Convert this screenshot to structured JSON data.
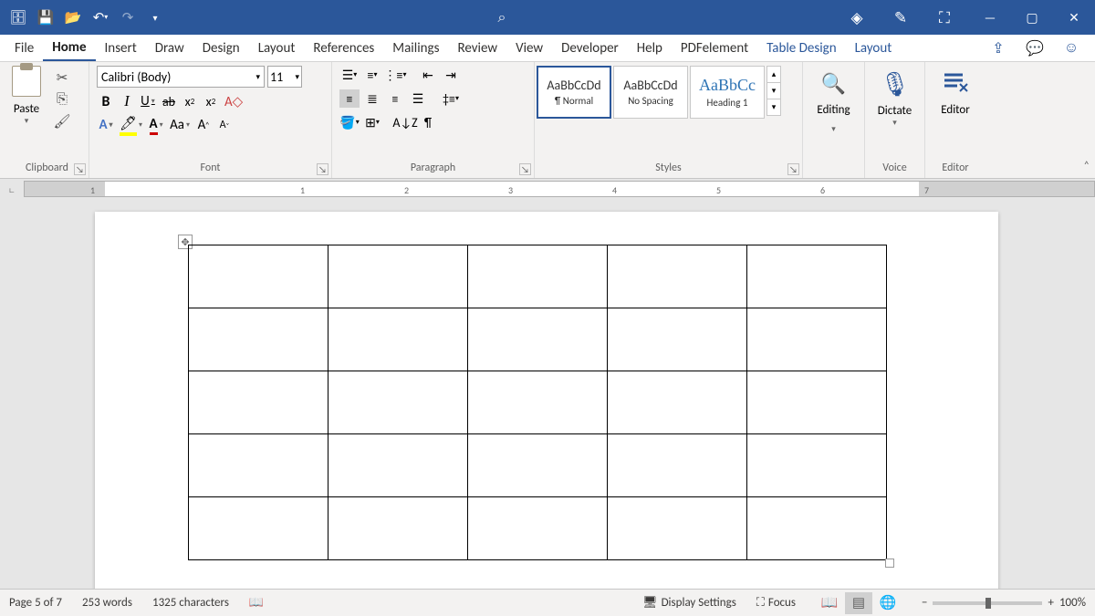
{
  "tabs": {
    "file": "File",
    "home": "Home",
    "insert": "Insert",
    "draw": "Draw",
    "design": "Design",
    "layout": "Layout",
    "references": "References",
    "mailings": "Mailings",
    "review": "Review",
    "view": "View",
    "developer": "Developer",
    "help": "Help",
    "pdf": "PDFelement",
    "table_design": "Table Design",
    "ctx_layout": "Layout"
  },
  "clipboard": {
    "paste": "Paste",
    "label": "Clipboard"
  },
  "font": {
    "family": "Calibri (Body)",
    "size": "11",
    "label": "Font"
  },
  "paragraph": {
    "label": "Paragraph"
  },
  "styles": {
    "label": "Styles",
    "preview": "AaBbCcDd",
    "preview_h1": "AaBbCc",
    "names": {
      "normal": "¶ Normal",
      "nospacing": "No Spacing",
      "h1": "Heading 1"
    }
  },
  "editing": {
    "label": "Editing"
  },
  "voice": {
    "dictate": "Dictate",
    "label": "Voice"
  },
  "editor": {
    "label": "Editor",
    "btn": "Editor"
  },
  "ruler": {
    "n1": "1",
    "n2": "2",
    "n3": "3",
    "n4": "4",
    "n5": "5",
    "n6": "6",
    "n7": "7"
  },
  "status": {
    "page": "Page 5 of 7",
    "words": "253 words",
    "chars": "1325 characters",
    "display": "Display Settings",
    "focus": "Focus",
    "zoom": "100%"
  },
  "table": {
    "rows": 5,
    "cols": 5
  }
}
